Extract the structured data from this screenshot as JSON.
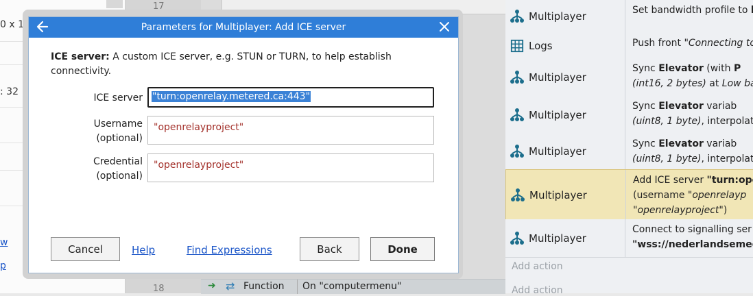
{
  "left_panel": {
    "texts": [
      "0 x 1",
      ": 32"
    ],
    "links": [
      "w",
      "p"
    ]
  },
  "rows": {
    "top_number": "17",
    "bottom_number": "18"
  },
  "bottom_event": {
    "kind": "Function",
    "condition": "On \"computermenu\""
  },
  "actions": [
    {
      "object": "Multiplayer",
      "icon": "multiplayer-icon",
      "desc_html": "Set bandwidth profile to <b>buffer)</b>"
    },
    {
      "object": "Logs",
      "icon": "grid-icon",
      "desc_html": "Push front <i>\"Connecting to</i>"
    },
    {
      "object": "Multiplayer",
      "icon": "multiplayer-icon",
      "desc_html": "Sync <b>Elevator</b> (with <b>P</b><br><i>(int16, 2 bytes)</i> at <i>Low ba</i>"
    },
    {
      "object": "Multiplayer",
      "icon": "multiplayer-icon",
      "desc_html": "Sync <b>Elevator</b> variab<br><i>(uint8, 1 byte)</i>, interpolat"
    },
    {
      "object": "Multiplayer",
      "icon": "multiplayer-icon",
      "desc_html": "Sync <b>Elevator</b> variab<br><i>(uint8, 1 byte)</i>, interpolat"
    },
    {
      "object": "Multiplayer",
      "icon": "multiplayer-icon",
      "desc_html": "Add ICE server <b>\"turn:ope</b><br>(username <i>\"openrelayp</i><br><i>\"openrelayproject\"</i>)"
    },
    {
      "object": "Multiplayer",
      "icon": "multiplayer-icon",
      "desc_html": "Connect to signalling ser<br><b>\"wss://nederlandsemed</b>"
    }
  ],
  "add_action_label": "Add action",
  "dialog": {
    "title": "Parameters for Multiplayer: Add ICE server",
    "desc_bold": "ICE server:",
    "desc_rest": " A custom ICE server, e.g. STUN or TURN, to help establish connectivity.",
    "fields": [
      {
        "label": "ICE server",
        "value": "\"turn:openrelay.metered.ca:443\""
      },
      {
        "label": "Username\n(optional)",
        "value": "\"openrelayproject\""
      },
      {
        "label": "Credential\n(optional)",
        "value": "\"openrelayproject\""
      }
    ],
    "buttons": {
      "cancel": "Cancel",
      "help": "Help",
      "find_expressions": "Find Expressions",
      "back": "Back",
      "done": "Done"
    }
  },
  "colors": {
    "titlebar": "#2f7ed8",
    "highlight_row": "#f1e6b6",
    "string_value": "#a3302a",
    "link": "#1a55c8",
    "selection": "#3b82d6"
  }
}
